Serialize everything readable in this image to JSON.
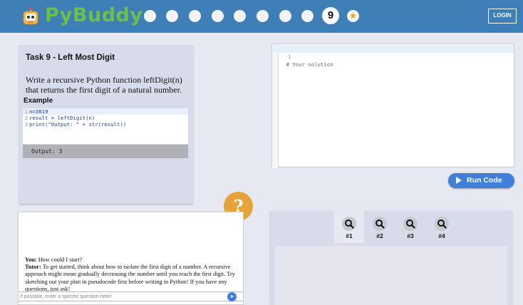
{
  "app": {
    "title": "PyBuddy",
    "login_label": "LOGIN",
    "progress": {
      "total_steps": 9,
      "current_step": "9",
      "star_icon": "star-icon"
    }
  },
  "task": {
    "title": "Task 9 - Left Most Digit",
    "description": "Write a recursive Python function leftDigit(n) that returns the first digit of a natural number.",
    "example_heading": "Example",
    "example_code": [
      {
        "num": "1",
        "text": "n=3819"
      },
      {
        "num": "2",
        "text": "result = leftDigit(n)"
      },
      {
        "num": "3",
        "text": "print(\"Output: \" + str(result))"
      }
    ],
    "example_output": "Output: 3"
  },
  "editor": {
    "line_number": "1",
    "content": "# Your solution",
    "run_label": "Run Code"
  },
  "help": {
    "label": "?"
  },
  "chat": {
    "user_prefix": "You:",
    "user_message": "How could I start?",
    "tutor_prefix": "Tutor:",
    "tutor_message": "To get started, think about how to isolate the first digit of a number. A recursive approach might mean gradually decreasing the number until you reach the first digit. Try sketching out your plan in pseudocode first before writing in Python! If you have any questions, just ask!",
    "input_placeholder": "If possible, enter a specific question here!"
  },
  "hints": {
    "tabs": [
      {
        "label": "#1",
        "icon": "magnifier-icon",
        "active": true
      },
      {
        "label": "#2",
        "icon": "magnifier-icon",
        "active": false
      },
      {
        "label": "#3",
        "icon": "magnifier-icon",
        "active": false
      },
      {
        "label": "#4",
        "icon": "magnifier-icon",
        "active": false
      }
    ]
  },
  "colors": {
    "header": "#3f7fb8",
    "brand_text": "#6cc04a",
    "accent_button": "#3f7fd8",
    "help_button": "#e7a23a",
    "panel": "#d8dbe9"
  }
}
